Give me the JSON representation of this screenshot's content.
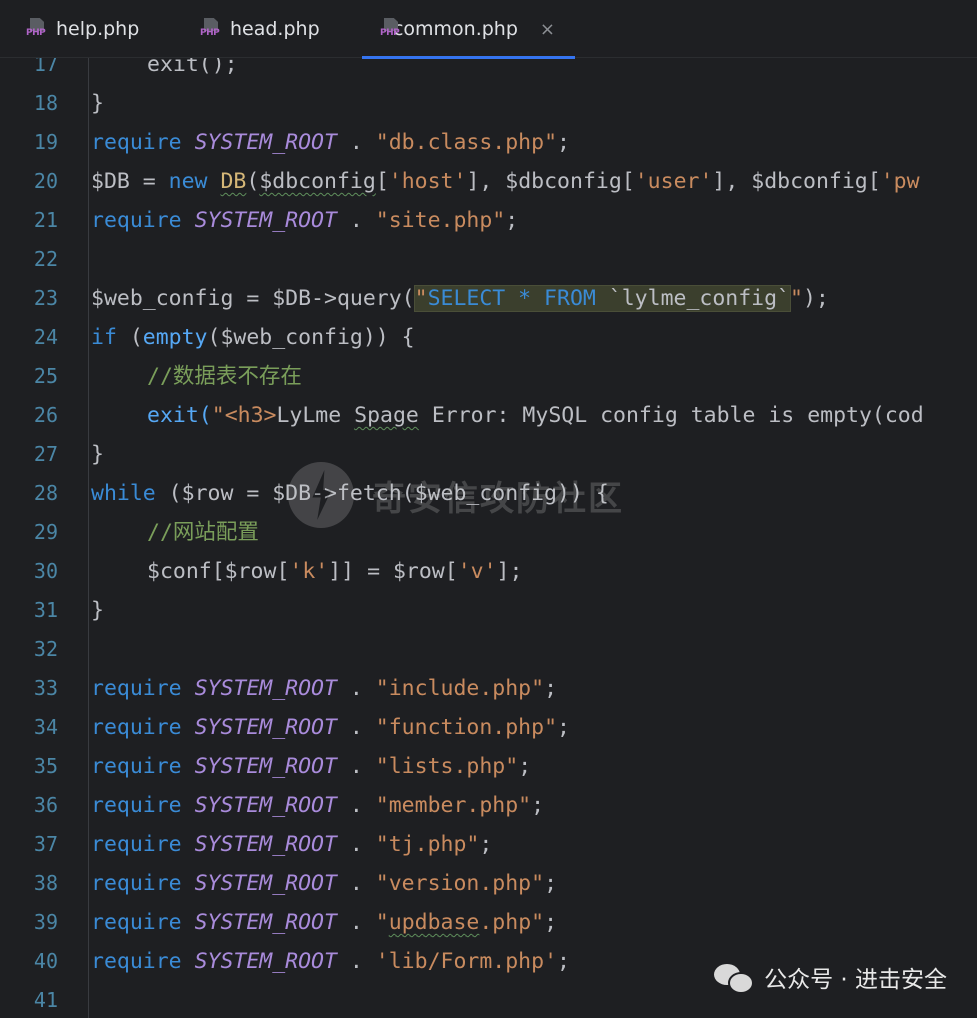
{
  "tabs": [
    {
      "label": "help.php",
      "icon": "php-file-icon"
    },
    {
      "label": "head.php",
      "icon": "php-file-icon"
    },
    {
      "label": "common.php",
      "icon": "php-file-icon",
      "active": true,
      "close": "×"
    }
  ],
  "php_icon_label": "PHP",
  "lines": {
    "l17": {
      "num": "17",
      "a": "exit",
      "b": "();"
    },
    "l18": {
      "num": "18",
      "a": "}"
    },
    "l19": {
      "num": "19",
      "kw": "require",
      "cst": "SYSTEM_ROOT",
      "dot": " . ",
      "str": "\"db.class.php\"",
      "end": ";"
    },
    "l20": {
      "num": "20",
      "a": "$DB = ",
      "kw": "new",
      "b": " ",
      "cls": "DB",
      "c": "(",
      "v1": "$dbconfig",
      "d": "[",
      "s1": "'host'",
      "e": "], ",
      "v2": "$dbconfig",
      "f": "[",
      "s2": "'user'",
      "g": "], ",
      "v3": "$dbconfig",
      "h": "[",
      "s3": "'pw"
    },
    "l21": {
      "num": "21",
      "kw": "require",
      "cst": "SYSTEM_ROOT",
      "dot": " . ",
      "str": "\"site.php\"",
      "end": ";"
    },
    "l22": {
      "num": "22"
    },
    "l23": {
      "num": "23",
      "a": "$web_config = $DB->query(",
      "q1": "\"",
      "sql1": "SELECT * FROM",
      "sql2": " `lylme_config`",
      "q2": "\"",
      "end": ");"
    },
    "l24": {
      "num": "24",
      "kw": "if",
      "a": " (",
      "fn": "empty",
      "b": "($web_config)) {"
    },
    "l25": {
      "num": "25",
      "cmt": "//数据表不存在"
    },
    "l26": {
      "num": "26",
      "a": "exit(",
      "q": "\"",
      "tag": "<h3>",
      "t1": "LyLme ",
      "t2": "Spage",
      "t3": " Error: MySQL config table is empty(cod"
    },
    "l27": {
      "num": "27",
      "a": "}"
    },
    "l28": {
      "num": "28",
      "kw": "while",
      "a": " ($row = $DB->fetch($web_config)) {"
    },
    "l29": {
      "num": "29",
      "cmt": "//网站配置"
    },
    "l30": {
      "num": "30",
      "a": "$conf[$row[",
      "s1": "'k'",
      "b": "]] = $row[",
      "s2": "'v'",
      "c": "];"
    },
    "l31": {
      "num": "31",
      "a": "}"
    },
    "l32": {
      "num": "32"
    },
    "l33": {
      "num": "33",
      "kw": "require",
      "cst": "SYSTEM_ROOT",
      "dot": " . ",
      "str": "\"include.php\"",
      "end": ";"
    },
    "l34": {
      "num": "34",
      "kw": "require",
      "cst": "SYSTEM_ROOT",
      "dot": " . ",
      "str": "\"function.php\"",
      "end": ";"
    },
    "l35": {
      "num": "35",
      "kw": "require",
      "cst": "SYSTEM_ROOT",
      "dot": " . ",
      "str": "\"lists.php\"",
      "end": ";"
    },
    "l36": {
      "num": "36",
      "kw": "require",
      "cst": "SYSTEM_ROOT",
      "dot": " . ",
      "str": "\"member.php\"",
      "end": ";"
    },
    "l37": {
      "num": "37",
      "kw": "require",
      "cst": "SYSTEM_ROOT",
      "dot": " . ",
      "str": "\"tj.php\"",
      "end": ";"
    },
    "l38": {
      "num": "38",
      "kw": "require",
      "cst": "SYSTEM_ROOT",
      "dot": " . ",
      "str": "\"version.php\"",
      "end": ";"
    },
    "l39": {
      "num": "39",
      "kw": "require",
      "cst": "SYSTEM_ROOT",
      "dot": " . ",
      "str1": "\"",
      "str2": "updbase",
      "str3": ".php\"",
      "end": ";"
    },
    "l40": {
      "num": "40",
      "kw": "require",
      "cst": "SYSTEM_ROOT",
      "dot": " . ",
      "str": "'lib/Form.php'",
      "end": ";"
    },
    "l41": {
      "num": "41"
    }
  },
  "watermark": {
    "center_text": "奇安信攻防社区",
    "bottom_text": "公众号 · 进击安全",
    "bottom_icon": "wechat-icon"
  },
  "colors": {
    "background": "#1e1f22",
    "keyword": "#3a8bd6",
    "constant": "#a98bdb",
    "string": "#c98b5f",
    "comment": "#7a9e5a",
    "line_number": "#4b86a6",
    "tab_underline": "#3574f0"
  }
}
